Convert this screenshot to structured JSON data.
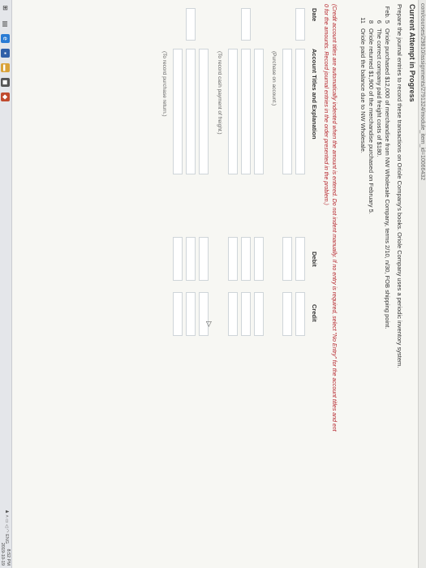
{
  "url": "com/courses/29810/assignments/2791324/module_item_id=10066432",
  "attempt_title": "Current Attempt in Progress",
  "question": "Prepare the journal entries to record these transactions on Oriole Company's books. Oriole Company uses a periodic inventory system.",
  "events": [
    {
      "date": "Feb. 5",
      "text": "Oriole purchased $12,000 of merchandise from NW Wholesale Company, terms 2/10, n/30, FOB shipping point."
    },
    {
      "date": "6",
      "text": "The correct company paid freight costs of $180."
    },
    {
      "date": "8",
      "text": "Oriole returned $1,900 of the merchandise purchased on February 5."
    },
    {
      "date": "11",
      "text": "Oriole paid the balance due to NW Wholesale."
    }
  ],
  "note_part1": "(Credit account titles are automatically indented when the amount is entered. Do not indent manually. If no entry is required, select \"No Entry\" for the account titles and ent",
  "note_part2": "0 for the amounts. Record journal entries in the order presented in the problem.)",
  "journal": {
    "col_date": "Date",
    "col_account": "Account Titles and Explanation",
    "col_debit": "Debit",
    "col_credit": "Credit",
    "memos": {
      "purchase": "(Purchase on account.)",
      "freight": "(To record cash payment of freight.)",
      "return": "(To record purchase return.)"
    }
  },
  "taskbar": {
    "tray_text": "ENG",
    "time": "8:52 PM",
    "date": "2019-10-19"
  },
  "colors": {
    "note_red": "#b4232a",
    "field_border": "#cfd5d9"
  }
}
